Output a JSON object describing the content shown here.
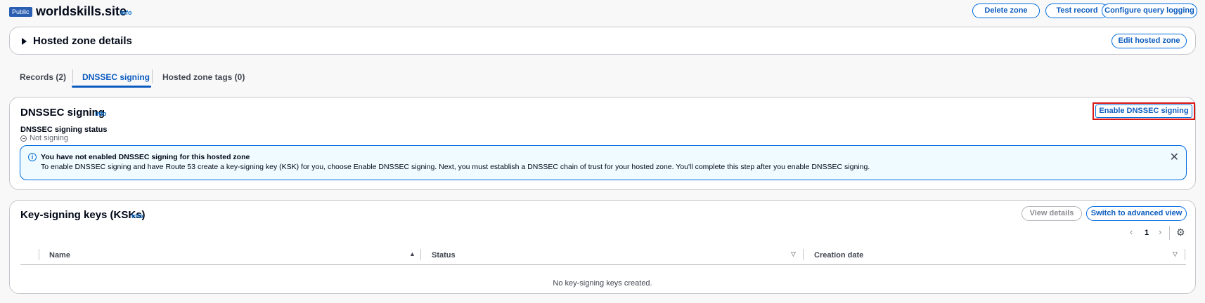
{
  "header": {
    "badge": "Public",
    "title": "worldskills.site",
    "info": "Info",
    "buttons": {
      "delete": "Delete zone",
      "test": "Test record",
      "logging": "Configure query logging"
    }
  },
  "hosted_zone_details": {
    "title": "Hosted zone details",
    "edit_button": "Edit hosted zone"
  },
  "tabs": [
    {
      "label": "Records (2)"
    },
    {
      "label": "DNSSEC signing"
    },
    {
      "label": "Hosted zone tags (0)"
    }
  ],
  "dnssec": {
    "title": "DNSSEC signing",
    "info": "Info",
    "enable_button": "Enable DNSSEC signing",
    "status_label": "DNSSEC signing status",
    "status_value": "Not signing",
    "flash": {
      "heading": "You have not enabled DNSSEC signing for this hosted zone",
      "body": "To enable DNSSEC signing and have Route 53 create a key-signing key (KSK) for you, choose Enable DNSSEC signing. Next, you must establish a DNSSEC chain of trust for your hosted zone. You'll complete this step after you enable DNSSEC signing."
    }
  },
  "ksk": {
    "title": "Key-signing keys (KSKs)",
    "info": "Info",
    "view_details": "View details",
    "advanced_view": "Switch to advanced view",
    "page": "1",
    "columns": [
      "Name",
      "Status",
      "Creation date"
    ],
    "empty": "No key-signing keys created."
  },
  "colors": {
    "accent": "#0b5cbf",
    "highlight": "#d91515",
    "flash_bg": "#f0fbff"
  }
}
